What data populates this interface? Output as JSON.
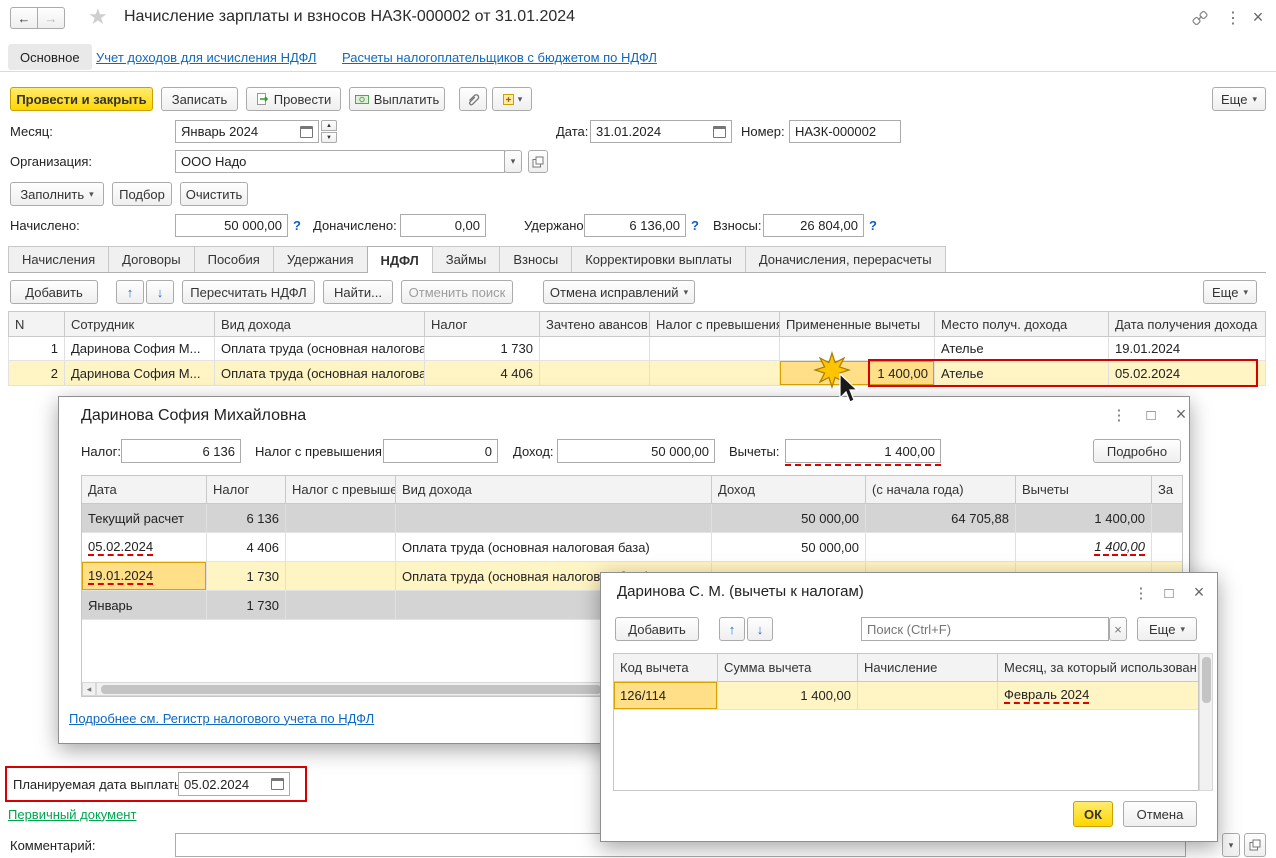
{
  "window": {
    "title": "Начисление зарплаты и взносов НАЗК-000002 от 31.01.2024",
    "nav_main_tab": "Основное",
    "nav_links": [
      "Учет доходов для исчисления НДФЛ",
      "Расчеты налогоплательщиков с бюджетом по НДФЛ"
    ]
  },
  "toolbar": {
    "post_and_close": "Провести и закрыть",
    "save": "Записать",
    "post": "Провести",
    "pay": "Выплатить",
    "more": "Еще"
  },
  "header_fields": {
    "month_label": "Месяц:",
    "month_value": "Январь 2024",
    "date_label": "Дата:",
    "date_value": "31.01.2024",
    "number_label": "Номер:",
    "number_value": "НАЗК-000002",
    "org_label": "Организация:",
    "org_value": "ООО Надо",
    "fill": "Заполнить",
    "pick": "Подбор",
    "clear": "Очистить",
    "accrued_label": "Начислено:",
    "accrued_value": "50 000,00",
    "extra_label": "Доначислено:",
    "extra_value": "0,00",
    "withheld_label": "Удержано:",
    "withheld_value": "6 136,00",
    "contrib_label": "Взносы:",
    "contrib_value": "26 804,00"
  },
  "section_tabs": [
    "Начисления",
    "Договоры",
    "Пособия",
    "Удержания",
    "НДФЛ",
    "Займы",
    "Взносы",
    "Корректировки выплаты",
    "Доначисления, перерасчеты"
  ],
  "grid_toolbar": {
    "add": "Добавить",
    "recalc": "Пересчитать НДФЛ",
    "find": "Найти...",
    "cancel_search": "Отменить поиск",
    "cancel_fixes": "Отмена исправлений",
    "more": "Еще"
  },
  "ndfl_grid": {
    "columns": [
      "N",
      "Сотрудник",
      "Вид дохода",
      "Налог",
      "Зачтено авансов",
      "Налог с превышения",
      "Примененные вычеты",
      "Место получ. дохода",
      "Дата получения дохода"
    ],
    "rows": [
      {
        "n": "1",
        "employee": "Даринова София М...",
        "income": "Оплата труда (основная налоговая...",
        "tax": "1 730",
        "advance": "",
        "excess": "",
        "deduction": "",
        "place": "Ателье",
        "date": "19.01.2024"
      },
      {
        "n": "2",
        "employee": "Даринова София М...",
        "income": "Оплата труда (основная налоговая...",
        "tax": "4 406",
        "advance": "",
        "excess": "",
        "deduction": "1 400,00",
        "place": "Ателье",
        "date": "05.02.2024"
      }
    ]
  },
  "employee_dialog": {
    "title": "Даринова София Михайловна",
    "tax_label": "Налог:",
    "tax_value": "6 136",
    "excess_label": "Налог с превышения:",
    "excess_value": "0",
    "income_label": "Доход:",
    "income_value": "50 000,00",
    "deduction_label": "Вычеты:",
    "deduction_value": "1 400,00",
    "details": "Подробно",
    "columns": [
      "Дата",
      "Налог",
      "Налог с превыше...",
      "Вид дохода",
      "Доход",
      "(с начала года)",
      "Вычеты",
      "За"
    ],
    "rows": [
      {
        "date": "Текущий расчет",
        "tax": "6 136",
        "excess": "",
        "income_type": "",
        "income": "50 000,00",
        "ytd": "64 705,88",
        "deduction": "1 400,00"
      },
      {
        "date": "05.02.2024",
        "tax": "4 406",
        "excess": "",
        "income_type": "Оплата труда (основная налоговая база)",
        "income": "50 000,00",
        "ytd": "",
        "deduction": "1 400,00"
      },
      {
        "date": "19.01.2024",
        "tax": "1 730",
        "excess": "",
        "income_type": "Оплата труда (основная налоговая база)",
        "income": "",
        "ytd": "",
        "deduction": ""
      },
      {
        "date": "Январь",
        "tax": "1 730",
        "excess": "",
        "income_type": "",
        "income": "",
        "ytd": "",
        "deduction": ""
      }
    ],
    "register_link": "Подробнее см. Регистр налогового учета по НДФЛ"
  },
  "deduction_dialog": {
    "title": "Даринова С. М. (вычеты к налогам)",
    "add": "Добавить",
    "search_placeholder": "Поиск (Ctrl+F)",
    "more": "Еще",
    "columns": [
      "Код вычета",
      "Сумма вычета",
      "Начисление",
      "Месяц, за который использован"
    ],
    "rows": [
      {
        "code": "126/114",
        "amount": "1 400,00",
        "accrual": "",
        "month": "Февраль 2024"
      }
    ],
    "ok": "ОК",
    "cancel": "Отмена"
  },
  "footer": {
    "planned_date_label": "Планируемая дата выплаты:",
    "planned_date_value": "05.02.2024",
    "primary_document_link": "Первичный документ",
    "comment_label": "Комментарий:"
  },
  "icons": {
    "back": "←",
    "forward": "→",
    "star": "★",
    "dots": "⋮",
    "close": "×",
    "maximize": "□",
    "chevron_down": "▾",
    "up_arrow": "↑",
    "down_arrow": "↓",
    "spin_up": "▲",
    "spin_down": "▼",
    "scroll_left": "◂",
    "scroll_right": "▸",
    "clear": "×",
    "help": "?"
  },
  "colors": {
    "accent_yellow": "#FFD600",
    "selection_yellow": "#FFF4C3",
    "highlight_cell": "#FFE089",
    "annotation_red": "#D60000",
    "link_blue": "#0E69C2",
    "link_green": "#00A550"
  }
}
